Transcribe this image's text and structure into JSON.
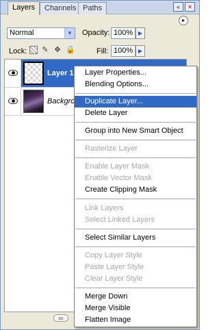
{
  "tabs": [
    {
      "label": "Layers",
      "active": true
    },
    {
      "label": "Channels",
      "active": false
    },
    {
      "label": "Paths",
      "active": false
    }
  ],
  "window_controls": {
    "close": "×",
    "minimize": "«",
    "menu": "▸"
  },
  "blend_mode": {
    "value": "Normal",
    "arrow": "▼"
  },
  "opacity": {
    "label": "Opacity:",
    "value": "100%",
    "arrow": "▶"
  },
  "lock": {
    "label": "Lock:",
    "brush": "✎",
    "move": "✥",
    "all": "🔒"
  },
  "fill": {
    "label": "Fill:",
    "value": "100%",
    "arrow": "▶"
  },
  "layers": [
    {
      "name": "Layer 1",
      "selected": true,
      "visible": true
    },
    {
      "name": "Backgrou",
      "selected": false,
      "visible": true
    }
  ],
  "bottom": {
    "link": "∞"
  },
  "context_menu": {
    "items": [
      {
        "label": "Layer Properties...",
        "disabled": false
      },
      {
        "label": "Blending Options...",
        "disabled": false
      },
      {
        "label": "Duplicate Layer...",
        "disabled": false,
        "highlight": true
      },
      {
        "label": "Delete Layer",
        "disabled": false
      },
      {
        "label": "Group into New Smart Object",
        "disabled": false
      },
      {
        "label": "Rasterize Layer",
        "disabled": true
      },
      {
        "label": "Enable Layer Mask",
        "disabled": true
      },
      {
        "label": "Enable Vector Mask",
        "disabled": true
      },
      {
        "label": "Create Clipping Mask",
        "disabled": false
      },
      {
        "label": "Link Layers",
        "disabled": true
      },
      {
        "label": "Select Linked Layers",
        "disabled": true
      },
      {
        "label": "Select Similar Layers",
        "disabled": false
      },
      {
        "label": "Copy Layer Style",
        "disabled": true
      },
      {
        "label": "Paste Layer Style",
        "disabled": true
      },
      {
        "label": "Clear Layer Style",
        "disabled": true
      },
      {
        "label": "Merge Down",
        "disabled": false
      },
      {
        "label": "Merge Visible",
        "disabled": false
      },
      {
        "label": "Flatten Image",
        "disabled": false
      }
    ]
  }
}
